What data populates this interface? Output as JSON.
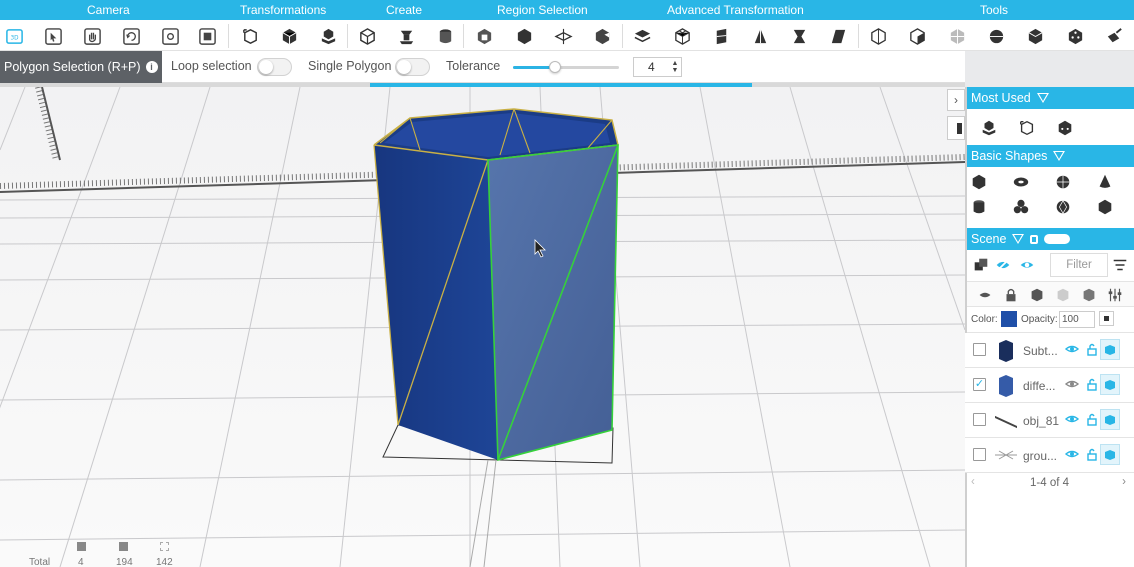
{
  "ribbon": {
    "tabs": [
      "Camera",
      "Transformations",
      "Create",
      "Region Selection",
      "Advanced Transformation",
      "Tools"
    ]
  },
  "options": {
    "mode_label": "Polygon Selection (R+P)",
    "loop_selection": "Loop selection",
    "single_polygon": "Single Polygon",
    "tolerance_label": "Tolerance",
    "tolerance_value": "4",
    "tolerance_level": 0.4
  },
  "stats": {
    "total_label": "Total",
    "values": [
      "4",
      "194",
      "142"
    ]
  },
  "panel": {
    "most_used": "Most Used",
    "basic_shapes": "Basic Shapes",
    "scene": "Scene",
    "filter_placeholder": "Filter",
    "color_label": "Color:",
    "color_value": "#1f4fa8",
    "opacity_label": "Opacity:",
    "opacity_value": "100",
    "rows": [
      {
        "name": "Subt...",
        "checked": false
      },
      {
        "name": "diffe...",
        "checked": true
      },
      {
        "name": "obj_81",
        "checked": false
      },
      {
        "name": "grou...",
        "checked": false
      }
    ],
    "pager": "1-4 of 4"
  },
  "colors": {
    "accent": "#29b6e6",
    "object_dark": "#1a3f8f",
    "object_face": "#4f6fa8",
    "selection_edge": "#36d13b"
  }
}
